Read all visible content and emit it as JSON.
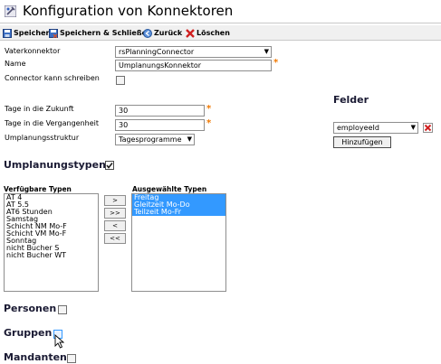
{
  "title": "Konfiguration von Konnektoren",
  "toolbar": {
    "save": "Speichern",
    "save_close": "Speichern & Schließen",
    "back": "Zurück",
    "delete": "Löschen"
  },
  "form": {
    "parent_label": "Vaterkonnektor",
    "parent_value": "rsPlanningConnector",
    "name_label": "Name",
    "name_value": "UmplanungsKonnektor",
    "can_write_label": "Connector kann schreiben",
    "days_future_label": "Tage in die Zukunft",
    "days_future_value": "30",
    "days_past_label": "Tage in die Vergangenheit",
    "days_past_value": "30",
    "structure_label": "Umplanungsstruktur",
    "structure_value": "Tagesprogramme"
  },
  "fields": {
    "heading": "Felder",
    "selected": "employeeId",
    "add_button": "Hinzufügen"
  },
  "types": {
    "heading": "Umplanungstypen",
    "available_label": "Verfügbare Typen",
    "selected_label": "Ausgewählte Typen",
    "available": [
      "AT 4",
      "AT 5.5",
      "AT6 Stunden",
      "Samstag",
      "Schicht NM Mo-F",
      "Schicht VM Mo-F",
      "Sonntag",
      "nicht Bucher S",
      "nicht Bucher WT"
    ],
    "selected": [
      "Freitag",
      "Gleitzeit Mo-Do",
      "Teilzeit Mo-Fr"
    ],
    "buttons": [
      ">",
      ">>",
      "<",
      "<<"
    ]
  },
  "sections": {
    "persons": "Personen",
    "groups": "Gruppen",
    "clients": "Mandanten"
  },
  "colors": {
    "selection": "#3399ff",
    "required": "#f07800",
    "delete": "#d02020"
  }
}
